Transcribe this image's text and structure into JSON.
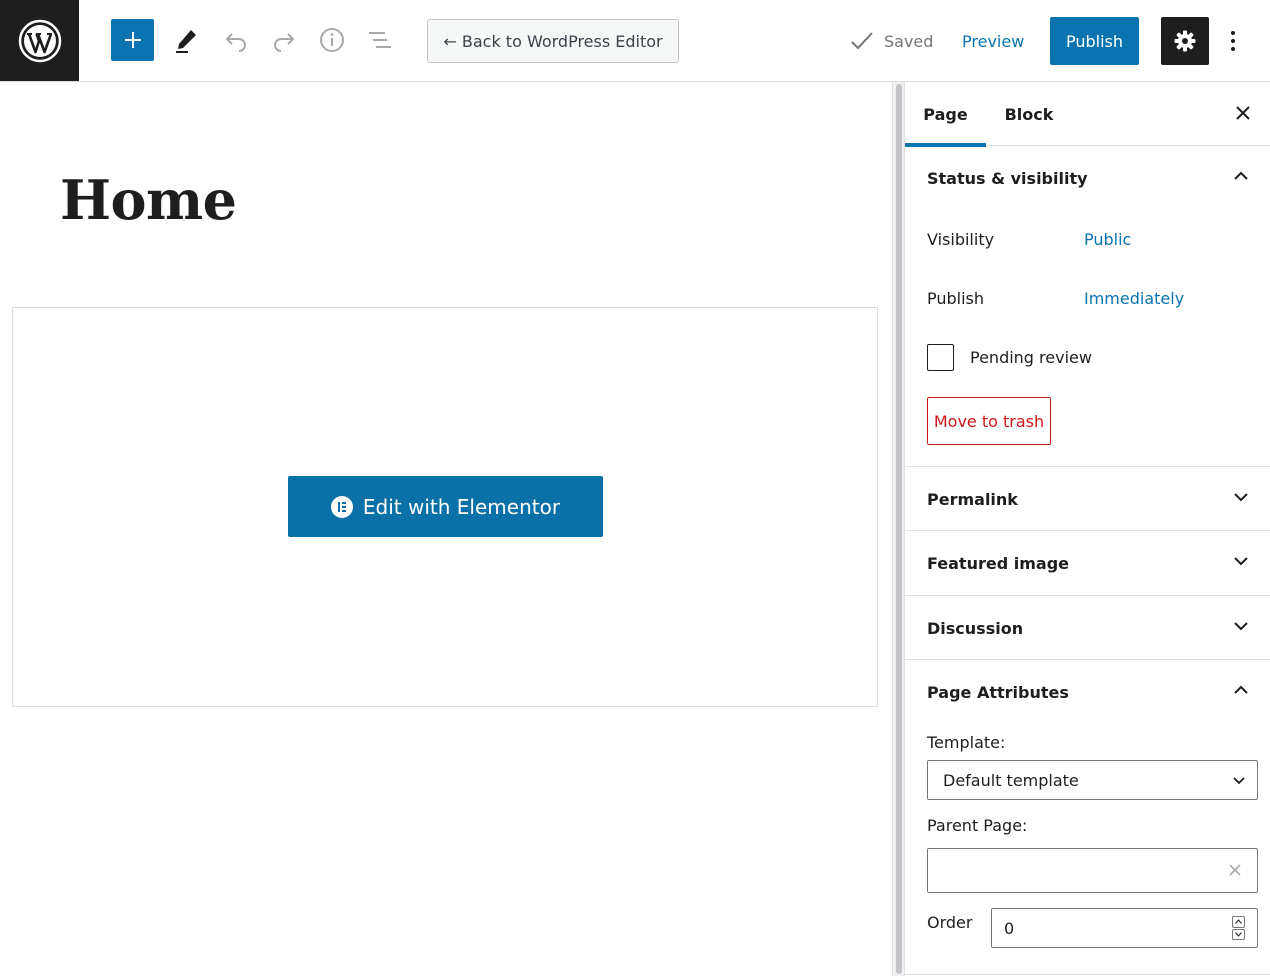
{
  "topbar": {
    "back_label": "← Back to WordPress Editor",
    "saved_label": "Saved",
    "preview_label": "Preview",
    "publish_label": "Publish"
  },
  "editor": {
    "page_title": "Home",
    "elementor_button_label": "Edit with Elementor"
  },
  "sidebar": {
    "tabs": [
      {
        "label": "Page",
        "active": true
      },
      {
        "label": "Block",
        "active": false
      }
    ],
    "status_visibility": {
      "title": "Status & visibility",
      "expanded": true,
      "visibility_label": "Visibility",
      "visibility_value": "Public",
      "publish_label": "Publish",
      "publish_value": "Immediately",
      "pending_review_label": "Pending review",
      "pending_review_checked": false,
      "trash_label": "Move to trash"
    },
    "permalink_title": "Permalink",
    "featured_image_title": "Featured image",
    "discussion_title": "Discussion",
    "page_attributes": {
      "title": "Page Attributes",
      "expanded": true,
      "template_label": "Template:",
      "template_value": "Default template",
      "parent_label": "Parent Page:",
      "parent_value": "",
      "order_label": "Order",
      "order_value": "0"
    }
  },
  "colors": {
    "accent": "#0a74b0",
    "dark": "#1e1e1e",
    "danger": "#cc1818"
  },
  "icons": [
    "wordpress-logo-icon",
    "plus-icon",
    "pencil-icon",
    "undo-icon",
    "redo-icon",
    "info-icon",
    "list-view-icon",
    "check-icon",
    "gear-icon",
    "more-vertical-icon",
    "close-icon",
    "chevron-up-icon",
    "chevron-down-icon",
    "elementor-icon"
  ]
}
